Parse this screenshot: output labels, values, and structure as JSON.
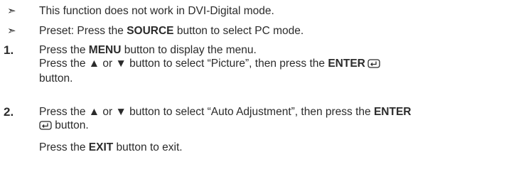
{
  "notes": [
    {
      "marker": "➣",
      "text": "This function does not work in DVI-Digital mode."
    },
    {
      "marker": "➣",
      "pre": "Preset: Press the ",
      "bold": "SOURCE",
      "post": " button to select PC mode."
    }
  ],
  "steps": [
    {
      "number": "1.",
      "line1_pre": "Press the ",
      "line1_bold": "MENU",
      "line1_post": " button to display the menu.",
      "line2_pre": "Press the ▲ or ▼ button to select “Picture”, then press the ",
      "line2_bold": "ENTER",
      "line3": "button."
    },
    {
      "number": "2.",
      "line1_pre": "Press the ▲ or ▼ button to select “Auto Adjustment”, then press the ",
      "line1_bold": "ENTER",
      "line2_post": " button.",
      "line3_pre": "Press the ",
      "line3_bold": "EXIT",
      "line3_post": " button to exit."
    }
  ],
  "icons": {
    "enter": "enter-icon"
  }
}
